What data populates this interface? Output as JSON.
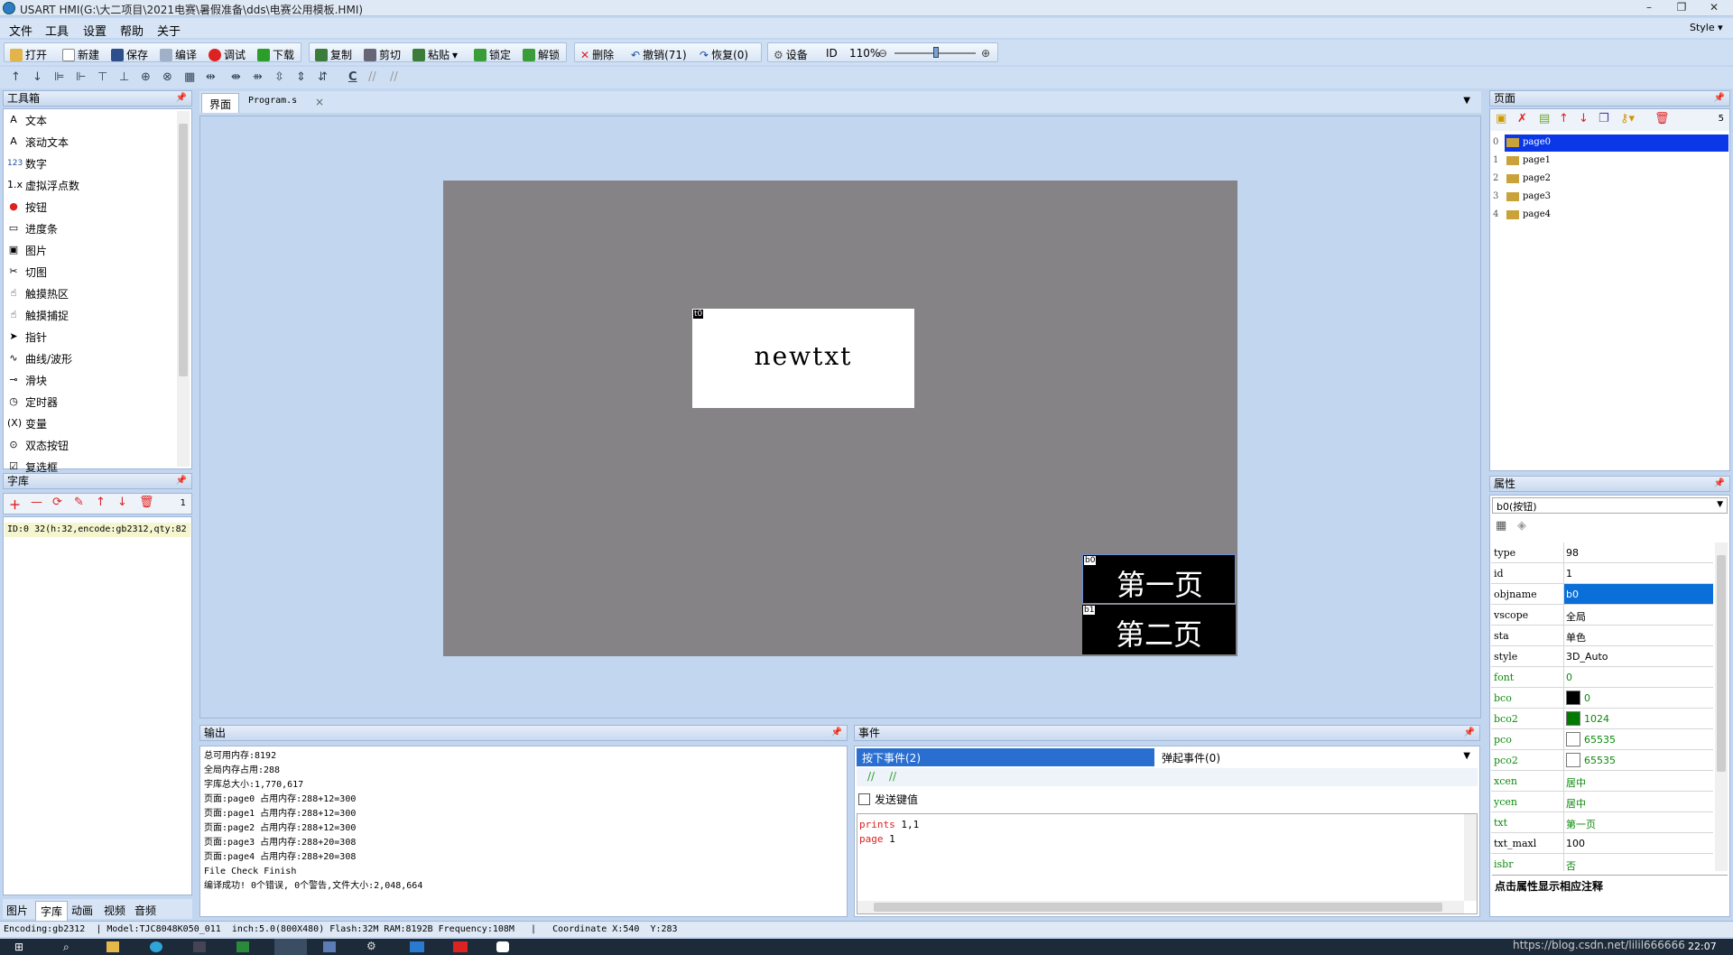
{
  "window": {
    "title": "USART HMI(G:\\大二项目\\2021电赛\\暑假准备\\dds\\电赛公用模板.HMI)",
    "minimize": "–",
    "restore": "❐",
    "close": "✕"
  },
  "menu": [
    "文件",
    "工具",
    "设置",
    "帮助",
    "关于"
  ],
  "style_menu": "Style ▾",
  "toolbar": {
    "open": "打开",
    "new": "新建",
    "save": "保存",
    "compile": "编译",
    "debug": "调试",
    "download": "下载",
    "copy": "复制",
    "cut": "剪切",
    "paste": "粘贴",
    "lock": "锁定",
    "unlock": "解锁",
    "delete": "删除",
    "undo": "撤销(71)",
    "redo": "恢复(0)",
    "settings": "设备",
    "id": "ID",
    "zoom": "110%"
  },
  "toolbar2": {
    "c_label": "C"
  },
  "toolbox": {
    "title": "工具箱",
    "items": [
      "文本",
      "滚动文本",
      "数字",
      "虚拟浮点数",
      "按钮",
      "进度条",
      "图片",
      "切图",
      "触摸热区",
      "触摸捕捉",
      "指针",
      "曲线/波形",
      "滑块",
      "定时器",
      "变量",
      "双态按钮",
      "复选框"
    ]
  },
  "fontlib": {
    "title": "字库",
    "count": "1",
    "entry": "ID:0  32(h:32,encode:gb2312,qty:82"
  },
  "bottom_tabs": [
    "图片",
    "字库",
    "动画",
    "视频",
    "音频"
  ],
  "editor_tabs": [
    "界面",
    "Program.s"
  ],
  "hmi": {
    "t0_label": "t0",
    "t0_text": "newtxt",
    "b0_label": "b0",
    "b0_text": "第一页",
    "b1_label": "b1",
    "b1_text": "第二页"
  },
  "output": {
    "title": "输出",
    "lines": [
      "总可用内存:8192",
      "全局内存占用:288",
      "字库总大小:1,770,617",
      "页面:page0 占用内存:288+12=300",
      "页面:page1 占用内存:288+12=300",
      "页面:page2 占用内存:288+12=300",
      "页面:page3 占用内存:288+20=308",
      "页面:page4 占用内存:288+20=308",
      "File Check Finish",
      "编译成功! 0个错误, 0个警告,文件大小:2,048,664"
    ]
  },
  "events": {
    "title": "事件",
    "tab_press": "按下事件(2)",
    "tab_release": "弹起事件(0)",
    "send_key": "发送键值",
    "code": [
      {
        "kw": "prints",
        "arg": " 1,1"
      },
      {
        "kw": "page",
        "arg": " 1"
      }
    ]
  },
  "pages": {
    "title": "页面",
    "count": "5",
    "list": [
      {
        "idx": "0",
        "name": "page0"
      },
      {
        "idx": "1",
        "name": "page1"
      },
      {
        "idx": "2",
        "name": "page2"
      },
      {
        "idx": "3",
        "name": "page3"
      },
      {
        "idx": "4",
        "name": "page4"
      }
    ]
  },
  "props": {
    "title": "属性",
    "selected": "b0(按钮)",
    "rows": [
      {
        "k": "type",
        "v": "98",
        "color": "#000"
      },
      {
        "k": "id",
        "v": "1",
        "color": "#000"
      },
      {
        "k": "objname",
        "v": "b0",
        "color": "#fff",
        "sel": true
      },
      {
        "k": "vscope",
        "v": "全局",
        "color": "#000"
      },
      {
        "k": "sta",
        "v": "单色",
        "color": "#000"
      },
      {
        "k": "style",
        "v": "3D_Auto",
        "color": "#000"
      },
      {
        "k": "font",
        "v": "0",
        "color": "#0a8a0a"
      },
      {
        "k": "bco",
        "v": "0",
        "color": "#0a8a0a",
        "swatch": "#000000"
      },
      {
        "k": "bco2",
        "v": "1024",
        "color": "#0a8a0a",
        "swatch": "#007a00"
      },
      {
        "k": "pco",
        "v": "65535",
        "color": "#0a8a0a",
        "swatch": "#ffffff"
      },
      {
        "k": "pco2",
        "v": "65535",
        "color": "#0a8a0a",
        "swatch": "#ffffff"
      },
      {
        "k": "xcen",
        "v": "居中",
        "color": "#0a8a0a"
      },
      {
        "k": "ycen",
        "v": "居中",
        "color": "#0a8a0a"
      },
      {
        "k": "txt",
        "v": "第一页",
        "color": "#0a8a0a"
      },
      {
        "k": "txt_maxl",
        "v": "100",
        "color": "#000"
      },
      {
        "k": "isbr",
        "v": "否",
        "color": "#0a8a0a"
      }
    ],
    "hint": "点击属性显示相应注释"
  },
  "status": "Encoding:gb2312  | Model:TJC8048K050_011  inch:5.0(800X480) Flash:32M RAM:8192B Frequency:108M   |   Coordinate X:540  Y:283",
  "taskbar": {
    "time": "22:07",
    "watermark": "https://blog.csdn.net/lilil666666"
  }
}
